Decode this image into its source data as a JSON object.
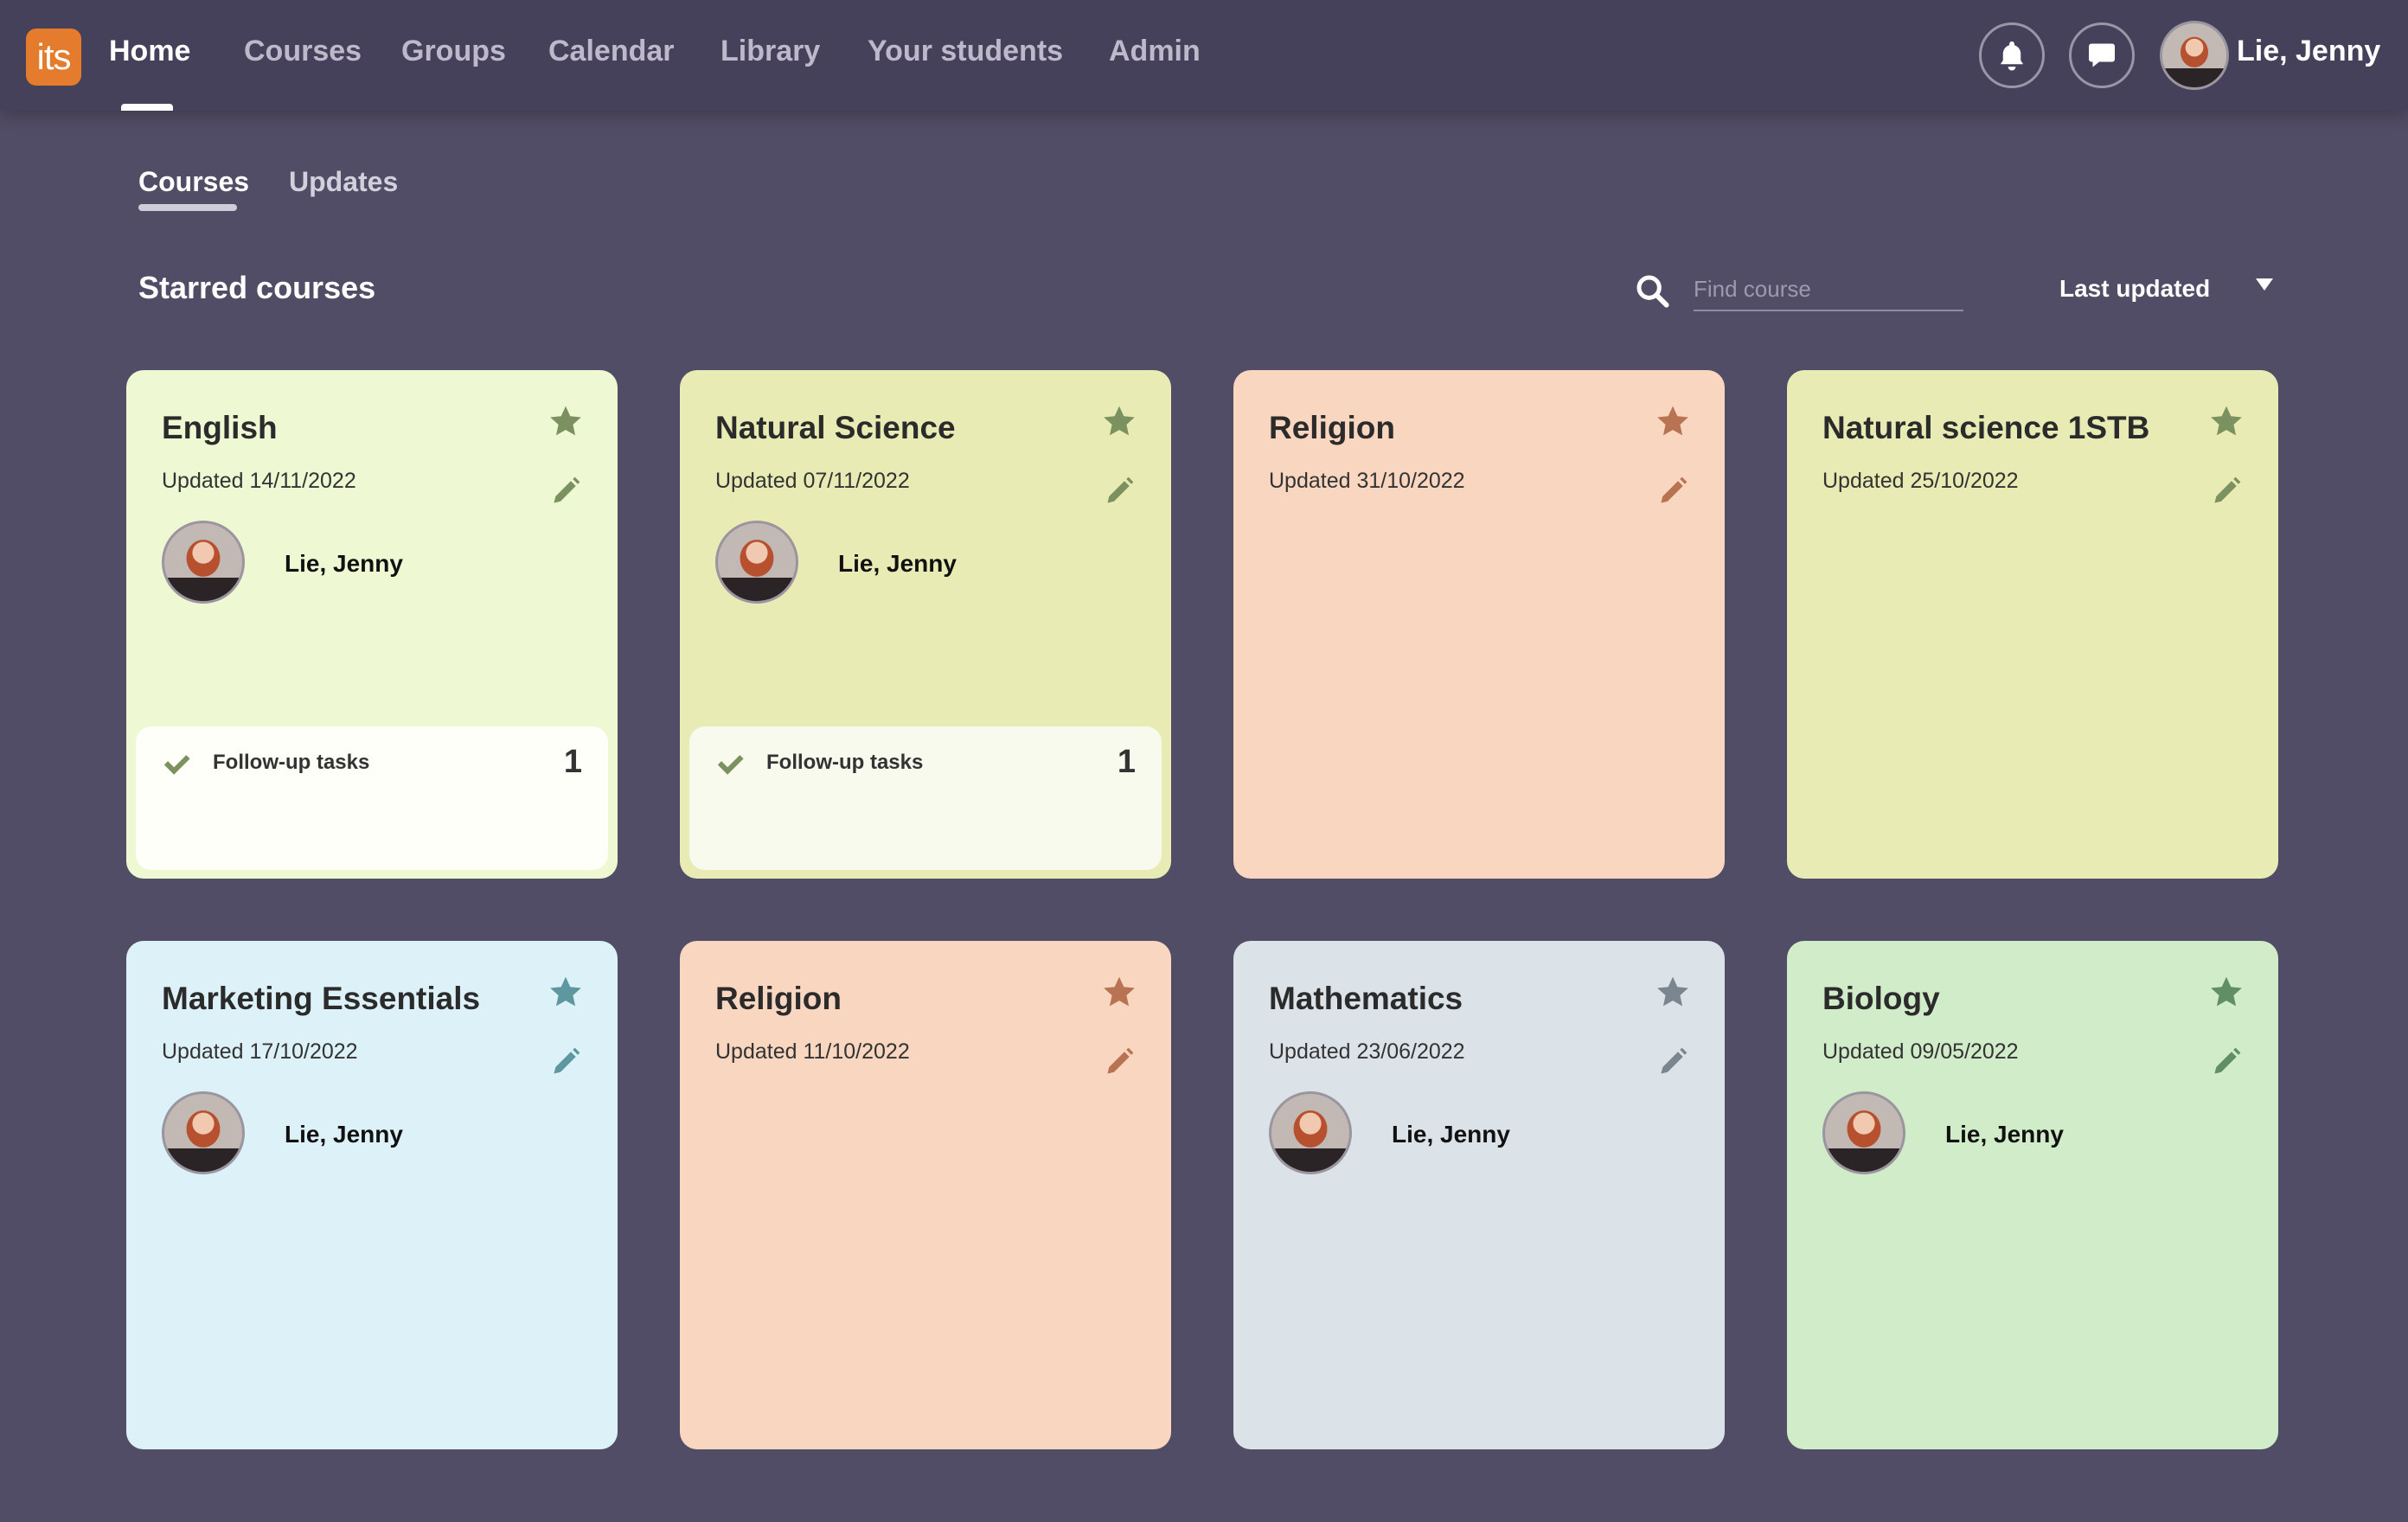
{
  "nav": {
    "logo": "its",
    "items": [
      "Home",
      "Courses",
      "Groups",
      "Calendar",
      "Library",
      "Your students",
      "Admin"
    ],
    "active": "Home",
    "user": "Lie, Jenny"
  },
  "tabs": [
    "Courses",
    "Updates"
  ],
  "section_title": "Starred courses",
  "search": {
    "placeholder": "Find course"
  },
  "sort": {
    "selected": "Last updated"
  },
  "courses": [
    {
      "title": "English",
      "updated": "Updated 14/11/2022",
      "owner": "Lie, Jenny",
      "followup": "Follow-up tasks",
      "followup_count": "1",
      "bg": "#eef8d3",
      "icon": "#7c9160"
    },
    {
      "title": "Natural Science",
      "updated": "Updated 07/11/2022",
      "owner": "Lie, Jenny",
      "followup": "Follow-up tasks",
      "followup_count": "1",
      "bg": "#e8ecb4",
      "icon": "#7c9160"
    },
    {
      "title": "Religion",
      "updated": "Updated 31/10/2022",
      "bg": "#f9d6bf",
      "icon": "#b87352"
    },
    {
      "title": "Natural science 1STB",
      "updated": "Updated 25/10/2022",
      "bg": "#e8ebb3",
      "icon": "#7c9160"
    },
    {
      "title": "Marketing Essentials",
      "updated": "Updated 17/10/2022",
      "owner": "Lie, Jenny",
      "bg": "#dcf2f8",
      "icon": "#5f97a0"
    },
    {
      "title": "Religion",
      "updated": "Updated 11/10/2022",
      "bg": "#f9d6bf",
      "icon": "#b87352"
    },
    {
      "title": "Mathematics",
      "updated": "Updated 23/06/2022",
      "owner": "Lie, Jenny",
      "bg": "#dbe3e8",
      "icon": "#7a8590"
    },
    {
      "title": "Biology",
      "updated": "Updated 09/05/2022",
      "owner": "Lie, Jenny",
      "bg": "#d1ecc8",
      "icon": "#5f8f62"
    }
  ]
}
